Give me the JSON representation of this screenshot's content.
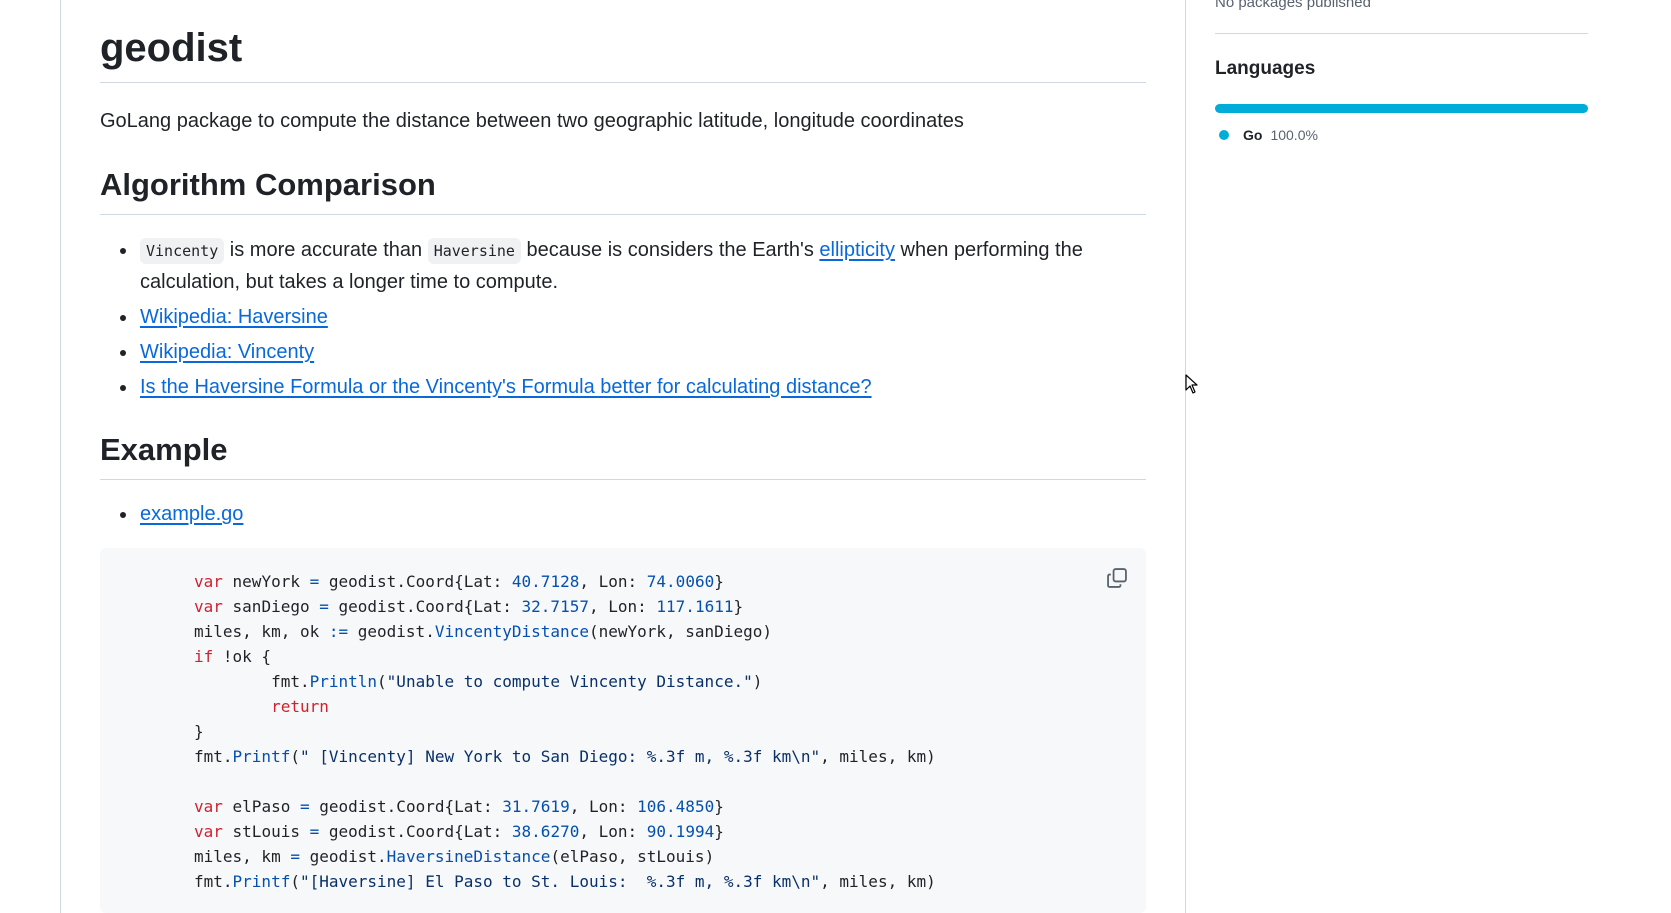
{
  "readme": {
    "title": "geodist",
    "description": "GoLang package to compute the distance between two geographic latitude, longitude coordinates",
    "algorithm_heading": "Algorithm Comparison",
    "algorithm_items": {
      "vincenty_code": "Vincenty",
      "text_1": " is more accurate than ",
      "haversine_code": "Haversine",
      "text_2": " because is considers the Earth's ",
      "ellipticity_link": "ellipticity",
      "text_3": " when performing the calculation, but takes a longer time to compute.",
      "links": [
        "Wikipedia: Haversine",
        "Wikipedia: Vincenty",
        "Is the Haversine Formula or the Vincenty's Formula better for calculating distance?"
      ]
    },
    "example_heading": "Example",
    "example_link": "example.go"
  },
  "sidebar": {
    "packages_text": "No packages published",
    "languages_heading": "Languages",
    "languages": [
      {
        "name": "Go",
        "percent": "100.0%",
        "color": "#00add8",
        "fraction": 1.0
      }
    ]
  },
  "colors": {
    "link": "#0969da",
    "keyword": "#cf222e",
    "number": "#0550ae",
    "go_language": "#00add8"
  },
  "icons": {
    "copy": "copy-icon",
    "cursor": "mouse-pointer-icon"
  }
}
